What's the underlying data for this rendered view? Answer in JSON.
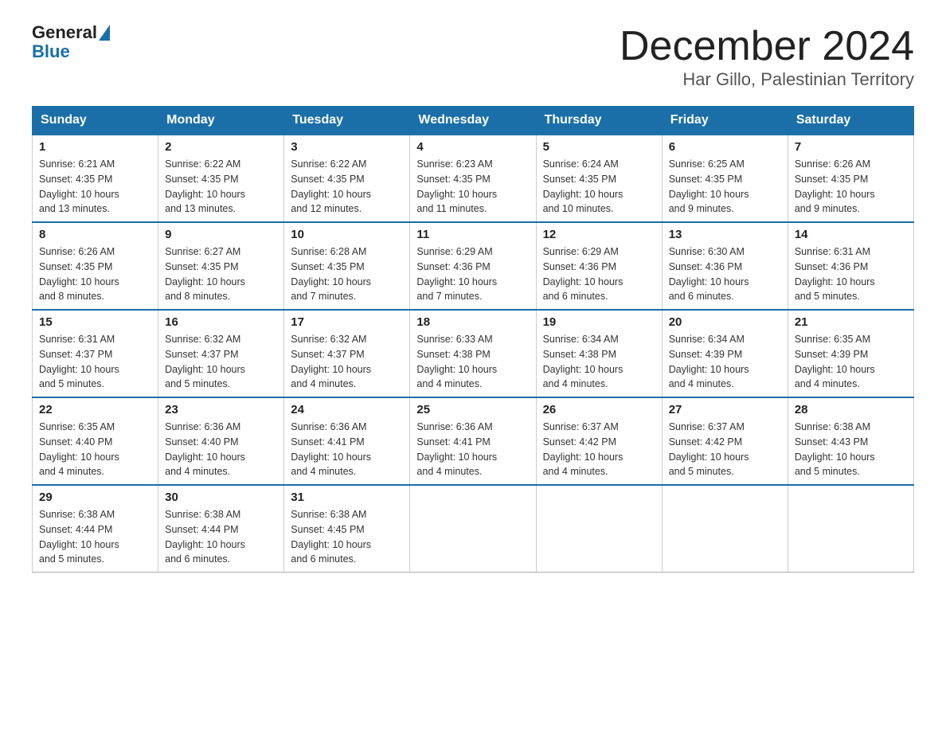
{
  "logo": {
    "general": "General",
    "blue": "Blue"
  },
  "title": "December 2024",
  "subtitle": "Har Gillo, Palestinian Territory",
  "days_of_week": [
    "Sunday",
    "Monday",
    "Tuesday",
    "Wednesday",
    "Thursday",
    "Friday",
    "Saturday"
  ],
  "weeks": [
    [
      {
        "day": "1",
        "sunrise": "6:21 AM",
        "sunset": "4:35 PM",
        "daylight": "10 hours and 13 minutes."
      },
      {
        "day": "2",
        "sunrise": "6:22 AM",
        "sunset": "4:35 PM",
        "daylight": "10 hours and 13 minutes."
      },
      {
        "day": "3",
        "sunrise": "6:22 AM",
        "sunset": "4:35 PM",
        "daylight": "10 hours and 12 minutes."
      },
      {
        "day": "4",
        "sunrise": "6:23 AM",
        "sunset": "4:35 PM",
        "daylight": "10 hours and 11 minutes."
      },
      {
        "day": "5",
        "sunrise": "6:24 AM",
        "sunset": "4:35 PM",
        "daylight": "10 hours and 10 minutes."
      },
      {
        "day": "6",
        "sunrise": "6:25 AM",
        "sunset": "4:35 PM",
        "daylight": "10 hours and 9 minutes."
      },
      {
        "day": "7",
        "sunrise": "6:26 AM",
        "sunset": "4:35 PM",
        "daylight": "10 hours and 9 minutes."
      }
    ],
    [
      {
        "day": "8",
        "sunrise": "6:26 AM",
        "sunset": "4:35 PM",
        "daylight": "10 hours and 8 minutes."
      },
      {
        "day": "9",
        "sunrise": "6:27 AM",
        "sunset": "4:35 PM",
        "daylight": "10 hours and 8 minutes."
      },
      {
        "day": "10",
        "sunrise": "6:28 AM",
        "sunset": "4:35 PM",
        "daylight": "10 hours and 7 minutes."
      },
      {
        "day": "11",
        "sunrise": "6:29 AM",
        "sunset": "4:36 PM",
        "daylight": "10 hours and 7 minutes."
      },
      {
        "day": "12",
        "sunrise": "6:29 AM",
        "sunset": "4:36 PM",
        "daylight": "10 hours and 6 minutes."
      },
      {
        "day": "13",
        "sunrise": "6:30 AM",
        "sunset": "4:36 PM",
        "daylight": "10 hours and 6 minutes."
      },
      {
        "day": "14",
        "sunrise": "6:31 AM",
        "sunset": "4:36 PM",
        "daylight": "10 hours and 5 minutes."
      }
    ],
    [
      {
        "day": "15",
        "sunrise": "6:31 AM",
        "sunset": "4:37 PM",
        "daylight": "10 hours and 5 minutes."
      },
      {
        "day": "16",
        "sunrise": "6:32 AM",
        "sunset": "4:37 PM",
        "daylight": "10 hours and 5 minutes."
      },
      {
        "day": "17",
        "sunrise": "6:32 AM",
        "sunset": "4:37 PM",
        "daylight": "10 hours and 4 minutes."
      },
      {
        "day": "18",
        "sunrise": "6:33 AM",
        "sunset": "4:38 PM",
        "daylight": "10 hours and 4 minutes."
      },
      {
        "day": "19",
        "sunrise": "6:34 AM",
        "sunset": "4:38 PM",
        "daylight": "10 hours and 4 minutes."
      },
      {
        "day": "20",
        "sunrise": "6:34 AM",
        "sunset": "4:39 PM",
        "daylight": "10 hours and 4 minutes."
      },
      {
        "day": "21",
        "sunrise": "6:35 AM",
        "sunset": "4:39 PM",
        "daylight": "10 hours and 4 minutes."
      }
    ],
    [
      {
        "day": "22",
        "sunrise": "6:35 AM",
        "sunset": "4:40 PM",
        "daylight": "10 hours and 4 minutes."
      },
      {
        "day": "23",
        "sunrise": "6:36 AM",
        "sunset": "4:40 PM",
        "daylight": "10 hours and 4 minutes."
      },
      {
        "day": "24",
        "sunrise": "6:36 AM",
        "sunset": "4:41 PM",
        "daylight": "10 hours and 4 minutes."
      },
      {
        "day": "25",
        "sunrise": "6:36 AM",
        "sunset": "4:41 PM",
        "daylight": "10 hours and 4 minutes."
      },
      {
        "day": "26",
        "sunrise": "6:37 AM",
        "sunset": "4:42 PM",
        "daylight": "10 hours and 4 minutes."
      },
      {
        "day": "27",
        "sunrise": "6:37 AM",
        "sunset": "4:42 PM",
        "daylight": "10 hours and 5 minutes."
      },
      {
        "day": "28",
        "sunrise": "6:38 AM",
        "sunset": "4:43 PM",
        "daylight": "10 hours and 5 minutes."
      }
    ],
    [
      {
        "day": "29",
        "sunrise": "6:38 AM",
        "sunset": "4:44 PM",
        "daylight": "10 hours and 5 minutes."
      },
      {
        "day": "30",
        "sunrise": "6:38 AM",
        "sunset": "4:44 PM",
        "daylight": "10 hours and 6 minutes."
      },
      {
        "day": "31",
        "sunrise": "6:38 AM",
        "sunset": "4:45 PM",
        "daylight": "10 hours and 6 minutes."
      },
      null,
      null,
      null,
      null
    ]
  ],
  "labels": {
    "sunrise": "Sunrise:",
    "sunset": "Sunset:",
    "daylight": "Daylight:"
  }
}
